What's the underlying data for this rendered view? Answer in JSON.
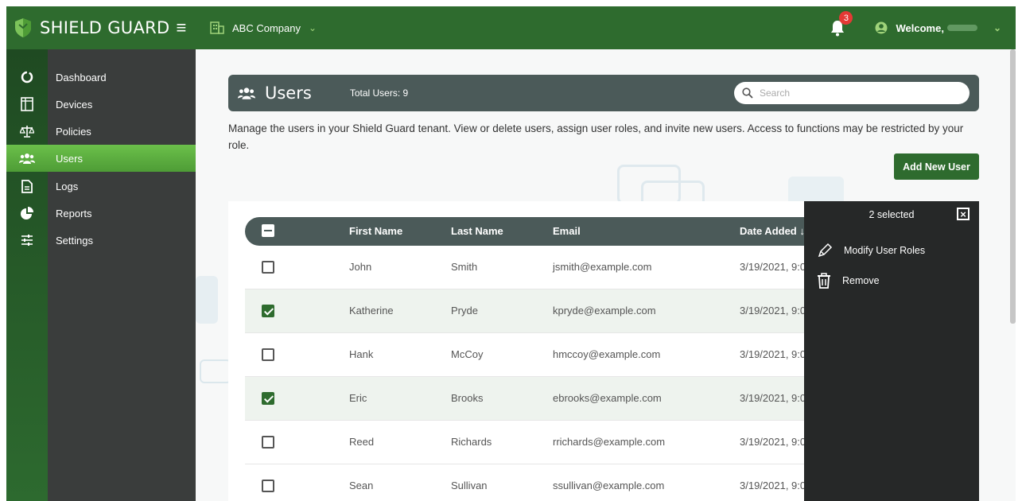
{
  "app": {
    "brand": "SHIELD GUARD",
    "company": "ABC Company",
    "notifications": "3",
    "welcome": "Welcome,"
  },
  "colors": {
    "topbar": "#2e6b2e",
    "accent": "#6bc04a",
    "sidebar": "#3a3d3c",
    "header": "#4b5a59",
    "panel": "#262828"
  },
  "sidebar": {
    "items": [
      {
        "label": "Dashboard",
        "icon": "dashboard-icon"
      },
      {
        "label": "Devices",
        "icon": "devices-icon"
      },
      {
        "label": "Policies",
        "icon": "scale-icon"
      },
      {
        "label": "Users",
        "icon": "users-icon",
        "active": true
      },
      {
        "label": "Logs",
        "icon": "document-icon"
      },
      {
        "label": "Reports",
        "icon": "pie-chart-icon"
      },
      {
        "label": "Settings",
        "icon": "sliders-icon"
      }
    ]
  },
  "users": {
    "title": "Users",
    "total": "Total Users: 9",
    "search_placeholder": "Search",
    "description": "Manage the users in your Shield Guard tenant. View or delete users, assign user roles, and invite new users. Access to functions may be restricted by your role.",
    "add_button": "Add New User"
  },
  "table": {
    "columns": [
      "First Name",
      "Last Name",
      "Email",
      "Date Added ↓"
    ],
    "rows": [
      {
        "first": "John",
        "last": "Smith",
        "email": "jsmith@example.com",
        "date": "3/19/2021, 9:0",
        "selected": false
      },
      {
        "first": "Katherine",
        "last": "Pryde",
        "email": "kpryde@example.com",
        "date": "3/19/2021, 9:0",
        "selected": true
      },
      {
        "first": "Hank",
        "last": "McCoy",
        "email": "hmccoy@example.com",
        "date": "3/19/2021, 9:0",
        "selected": false
      },
      {
        "first": "Eric",
        "last": "Brooks",
        "email": "ebrooks@example.com",
        "date": "3/19/2021, 9:0",
        "selected": true
      },
      {
        "first": "Reed",
        "last": "Richards",
        "email": "rrichards@example.com",
        "date": "3/19/2021, 9:0",
        "selected": false
      },
      {
        "first": "Sean",
        "last": "Sullivan",
        "email": "ssullivan@example.com",
        "date": "3/19/2021, 9:0",
        "selected": false
      }
    ]
  },
  "panel": {
    "count": "2 selected",
    "actions": [
      {
        "label": "Modify User Roles",
        "icon": "pencil-icon"
      },
      {
        "label": "Remove",
        "icon": "trash-icon"
      }
    ]
  }
}
